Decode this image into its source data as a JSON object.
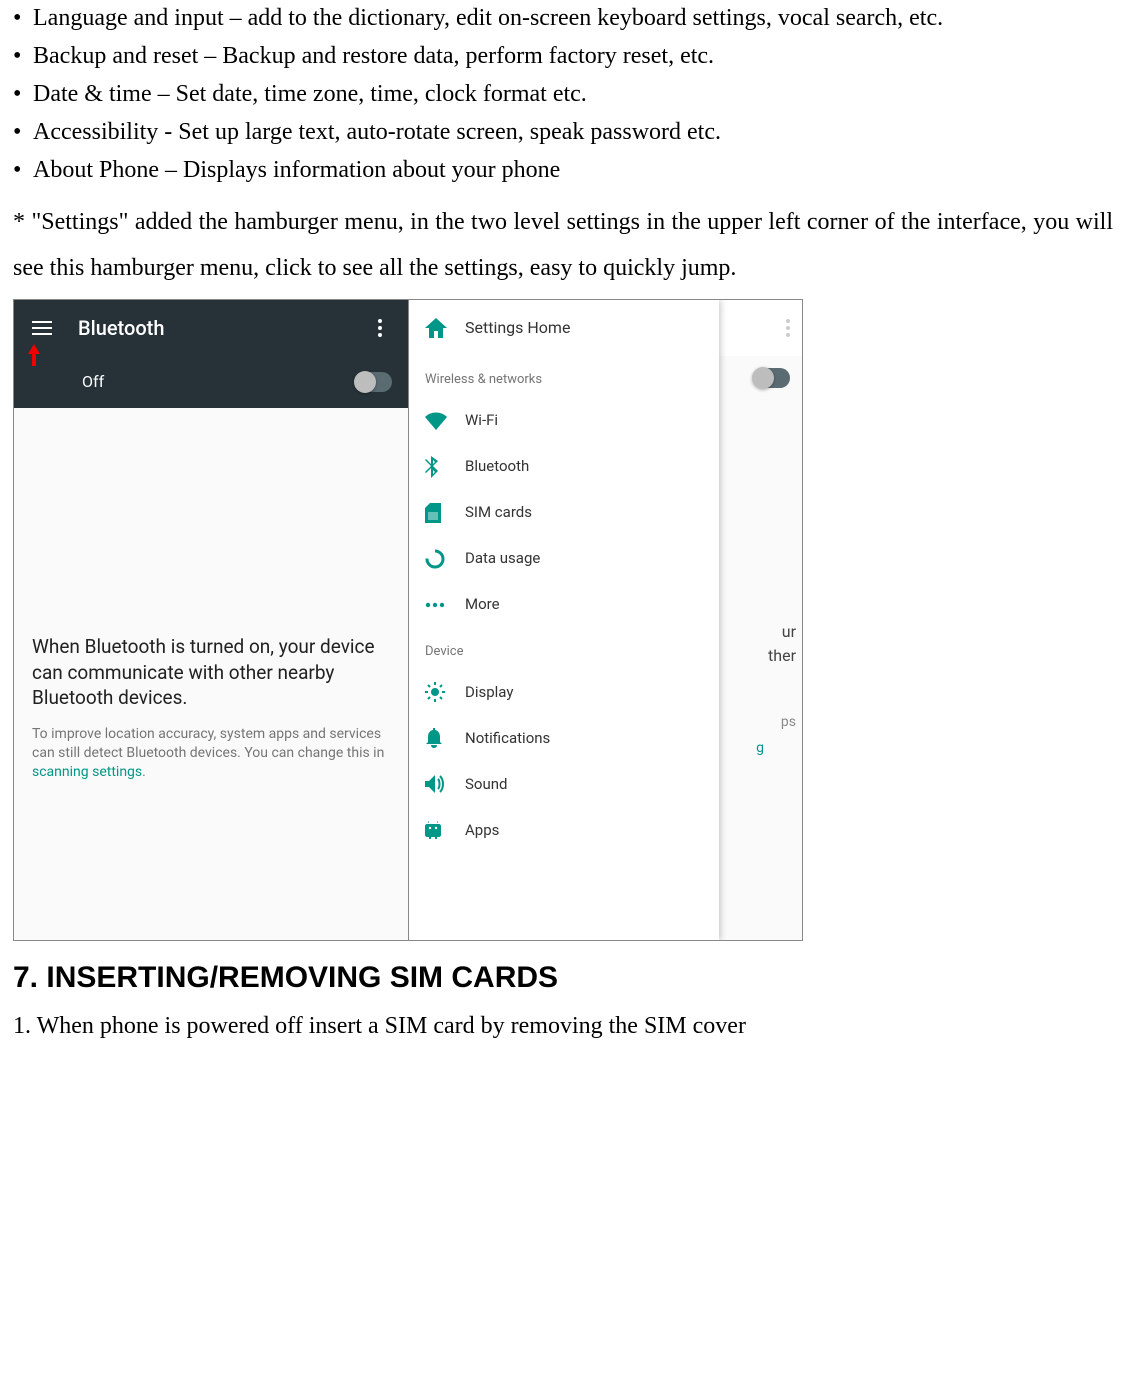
{
  "bullets": [
    "Language and input – add to the dictionary, edit on-screen keyboard settings, vocal search, etc.",
    "Backup and reset – Backup and restore data, perform factory reset, etc.",
    "Date & time – Set date, time zone, time, clock format etc.",
    "Accessibility - Set up large text, auto-rotate screen, speak password etc.",
    "About Phone – Displays information about your phone"
  ],
  "note": "* \"Settings\" added the hamburger menu, in the two level settings in the upper left corner of the interface, you will see this hamburger menu, click to see all the settings, easy to quickly jump.",
  "left_screen": {
    "title": "Bluetooth",
    "toggle_label": "Off",
    "primary_text": "When Bluetooth is turned on, your device can communicate with other nearby Bluetooth devices.",
    "secondary_prefix": "To improve location accuracy, system apps and services can still detect Bluetooth devices. You can change this in ",
    "secondary_link": "scanning settings",
    "secondary_suffix": "."
  },
  "right_screen": {
    "home": "Settings Home",
    "section1": "Wireless & networks",
    "items1": [
      "Wi-Fi",
      "Bluetooth",
      "SIM cards",
      "Data usage",
      "More"
    ],
    "section2": "Device",
    "items2": [
      "Display",
      "Notifications",
      "Sound",
      "Apps"
    ],
    "bg_text1": "ur",
    "bg_text2": "ther",
    "bg_text3": "ps",
    "bg_link": "g"
  },
  "section_header": "7. INSERTING/REMOVING SIM CARDS",
  "step1": "1. When phone is powered off insert a SIM card by removing the SIM cover"
}
